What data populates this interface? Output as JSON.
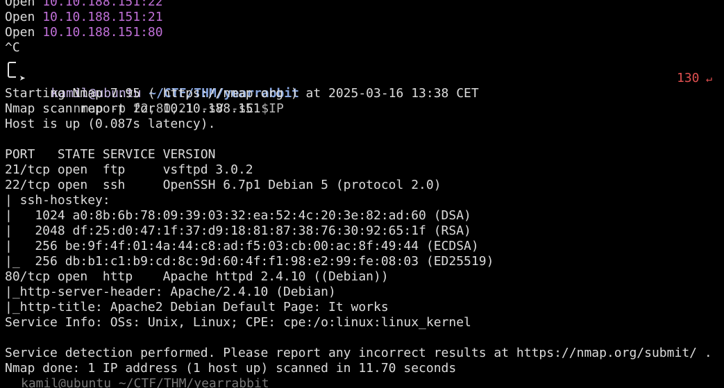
{
  "terminal": {
    "open_label": "Open",
    "open_ports": [
      "10.10.188.151:22",
      "10.10.188.151:21",
      "10.10.188.151:80"
    ],
    "interrupt": "^C",
    "prompt": {
      "user_host": "kamil@ubuntu",
      "cwd": "~/CTF/THM/yearrabbit",
      "command": "nmap -p 22,80,21 -sV -sC $IP",
      "exit_code": "130",
      "return_icon": "↵"
    },
    "output": [
      "Starting Nmap 7.95 ( https://nmap.org ) at 2025-03-16 13:38 CET",
      "Nmap scan report for 10.10.188.151",
      "Host is up (0.087s latency).",
      "",
      "PORT   STATE SERVICE VERSION",
      "21/tcp open  ftp     vsftpd 3.0.2",
      "22/tcp open  ssh     OpenSSH 6.7p1 Debian 5 (protocol 2.0)",
      "| ssh-hostkey:",
      "|   1024 a0:8b:6b:78:09:39:03:32:ea:52:4c:20:3e:82:ad:60 (DSA)",
      "|   2048 df:25:d0:47:1f:37:d9:18:81:87:38:76:30:92:65:1f (RSA)",
      "|   256 be:9f:4f:01:4a:44:c8:ad:f5:03:cb:00:ac:8f:49:44 (ECDSA)",
      "|_  256 db:b1:c1:b9:cd:8c:9d:60:4f:f1:98:e2:99:fe:08:03 (ED25519)",
      "80/tcp open  http    Apache httpd 2.4.10 ((Debian))",
      "|_http-server-header: Apache/2.4.10 (Debian)",
      "|_http-title: Apache2 Debian Default Page: It works",
      "Service Info: OSs: Unix, Linux; CPE: cpe:/o:linux:linux_kernel",
      "",
      "Service detection performed. Please report any incorrect results at https://nmap.org/submit/ .",
      "Nmap done: 1 IP address (1 host up) scanned in 11.70 seconds"
    ],
    "cut_off_line": "kamil@ubuntu ~/CTF/THM/yearrabbit"
  }
}
